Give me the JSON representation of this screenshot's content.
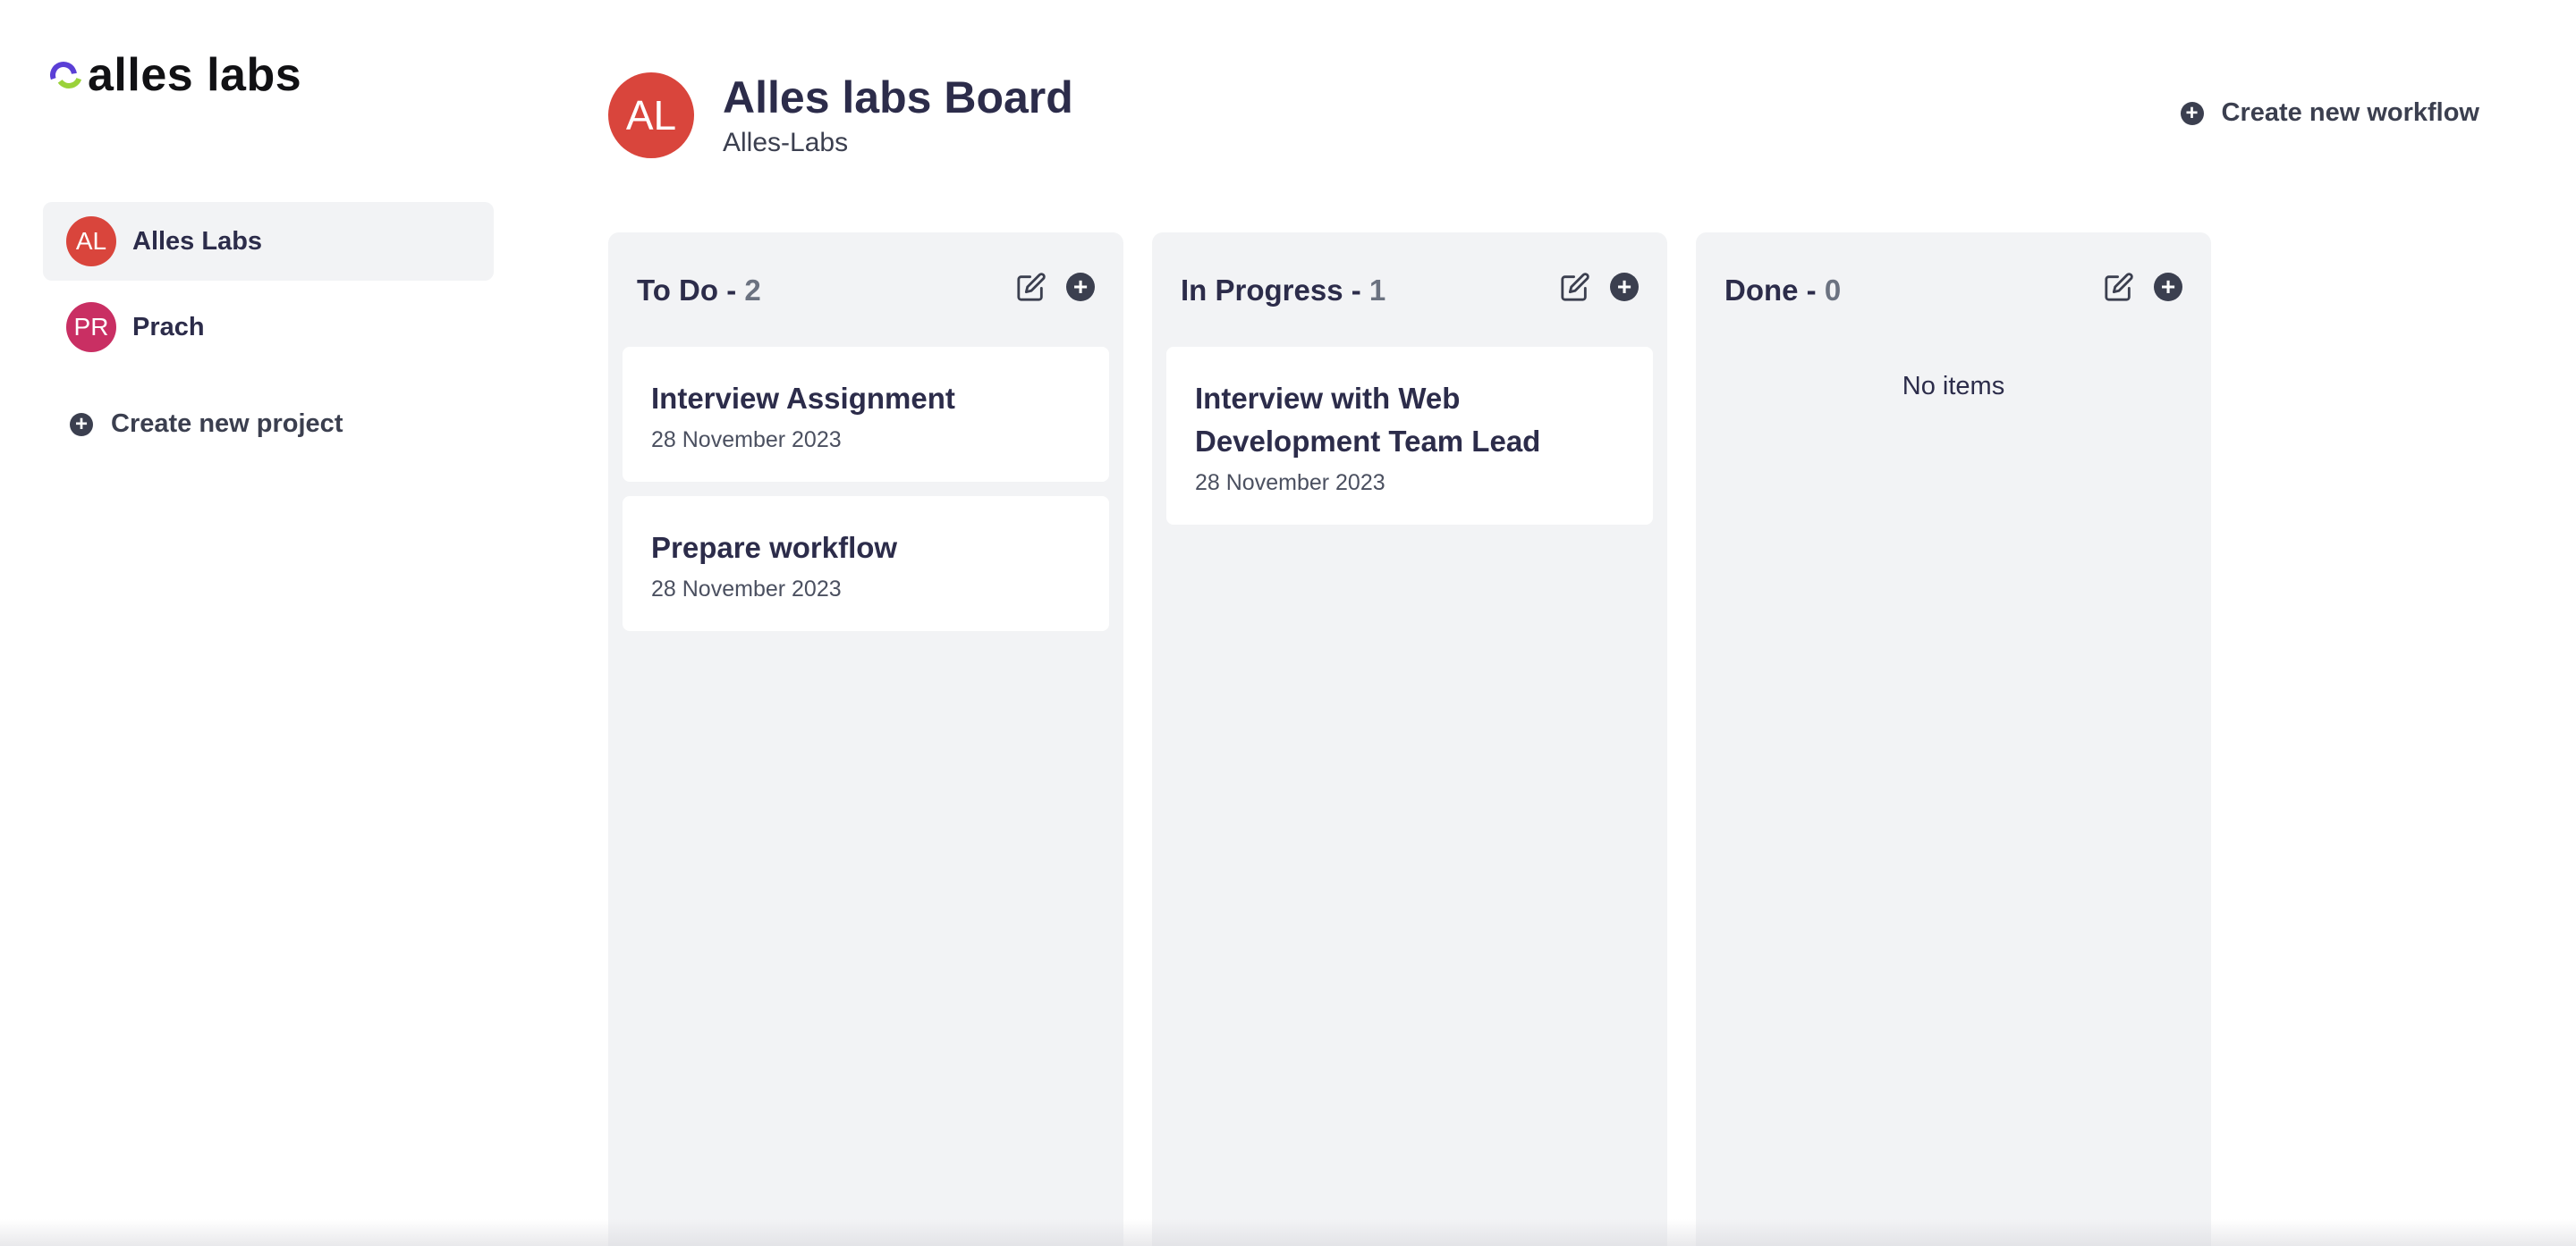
{
  "brand": {
    "name": "alles labs"
  },
  "sidebar": {
    "projects": [
      {
        "initials": "AL",
        "name": "Alles Labs",
        "color": "#d9453c",
        "active": true
      },
      {
        "initials": "PR",
        "name": "Prach",
        "color": "#c92f63",
        "active": false
      }
    ],
    "create_project_label": "Create new project"
  },
  "header": {
    "initials": "AL",
    "avatar_color": "#d9453c",
    "title": "Alles labs Board",
    "subtitle": "Alles-Labs",
    "create_workflow_label": "Create new workflow"
  },
  "columns": [
    {
      "name": "To Do",
      "separator": " - ",
      "count": "2",
      "cards": [
        {
          "title": "Interview Assignment",
          "date": "28 November 2023"
        },
        {
          "title": "Prepare workflow",
          "date": "28 November 2023"
        }
      ]
    },
    {
      "name": "In Progress",
      "separator": " - ",
      "count": "1",
      "cards": [
        {
          "title": "Interview with Web Development Team Lead",
          "date": "28 November 2023"
        }
      ]
    },
    {
      "name": "Done",
      "separator": " - ",
      "count": "0",
      "cards": [],
      "empty_text": "No items"
    }
  ],
  "icons": {
    "plus": "plus-circle-icon",
    "edit": "edit-icon"
  }
}
